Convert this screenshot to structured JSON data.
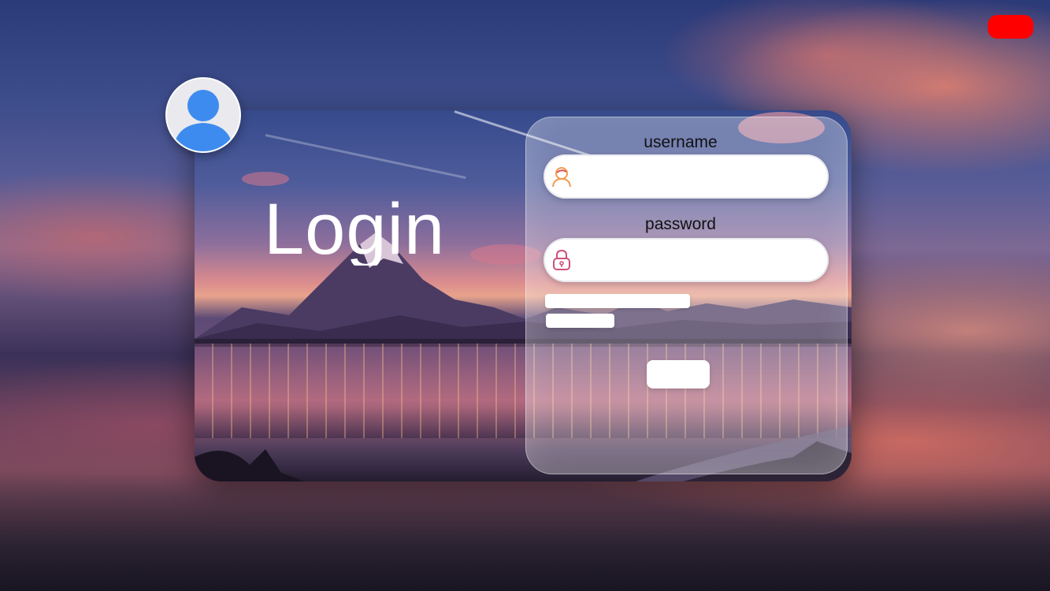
{
  "title": "Login",
  "form": {
    "username_label": "username",
    "username_value": "",
    "password_label": "password",
    "password_value": ""
  },
  "icons": {
    "avatar": "user-avatar-icon",
    "username": "user-icon",
    "password": "lock-icon",
    "close": "close-button"
  },
  "colors": {
    "close_button": "#ff0000",
    "avatar_fill": "#3d8bef",
    "user_icon": "#f29a52",
    "lock_icon": "#d0507a"
  }
}
